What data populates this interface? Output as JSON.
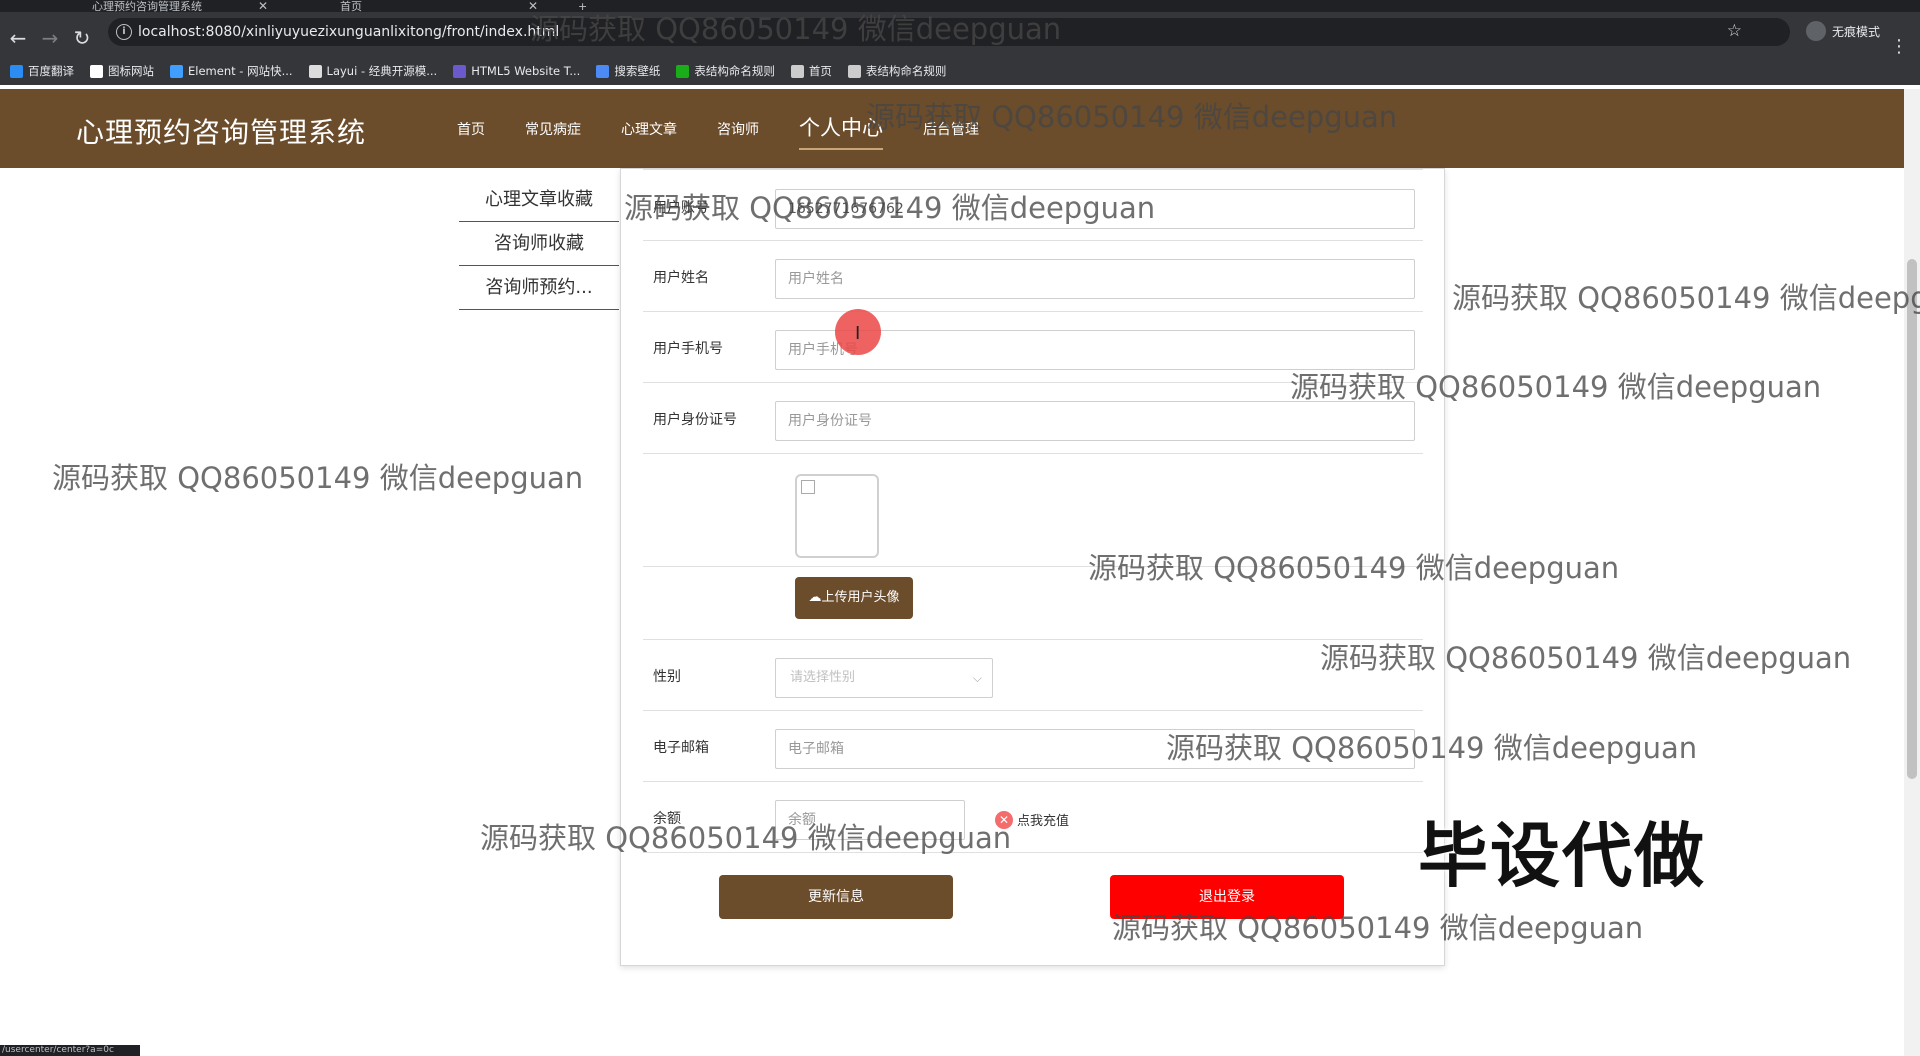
{
  "browser": {
    "tabs": [
      {
        "title": "心理预约咨询管理系统"
      },
      {
        "title": "首页"
      }
    ],
    "url": "localhost:8080/xinliyuyuezixunguanlixitong/front/index.html",
    "incognito_label": "无痕模式",
    "bookmarks": [
      {
        "label": "百度翻译",
        "color": "#2b8cf3"
      },
      {
        "label": "图标网站",
        "color": "#ffffff"
      },
      {
        "label": "Element - 网站快...",
        "color": "#409eff"
      },
      {
        "label": "Layui - 经典开源模...",
        "color": "#dddddd"
      },
      {
        "label": "HTML5 Website T...",
        "color": "#6a5acd"
      },
      {
        "label": "搜索壁纸",
        "color": "#4c8bf5"
      },
      {
        "label": "表结构命名规则",
        "color": "#1aad19"
      },
      {
        "label": "首页",
        "color": "#cccccc"
      },
      {
        "label": "表结构命名规则",
        "color": "#cccccc"
      }
    ],
    "status_text": "/usercenter/center?a=0c"
  },
  "site": {
    "logo": "心理预约咨询管理系统",
    "nav": [
      "首页",
      "常见病症",
      "心理文章",
      "咨询师",
      "个人中心",
      "后台管理"
    ],
    "active_nav": "个人中心",
    "brand_color": "#6b4c2b"
  },
  "side_menu": [
    "心理文章收藏",
    "咨询师收藏",
    "咨询师预约..."
  ],
  "form": {
    "account_label": "用户账号",
    "account_value": "1652771676762",
    "name_label": "用户姓名",
    "name_placeholder": "用户姓名",
    "phone_label": "用户手机号",
    "phone_placeholder": "用户手机号",
    "idcard_label": "用户身份证号",
    "idcard_placeholder": "用户身份证号",
    "upload_label": "上传用户头像",
    "gender_label": "性别",
    "gender_placeholder": "请选择性别",
    "email_label": "电子邮箱",
    "email_placeholder": "电子邮箱",
    "balance_label": "余额",
    "balance_placeholder": "余额",
    "recharge_label": "点我充值",
    "update_button": "更新信息",
    "logout_button": "退出登录",
    "logout_color": "#ff0000"
  },
  "overlay": {
    "watermark": "源码获取 QQ86050149 微信deepguan",
    "promo": "毕设代做"
  }
}
